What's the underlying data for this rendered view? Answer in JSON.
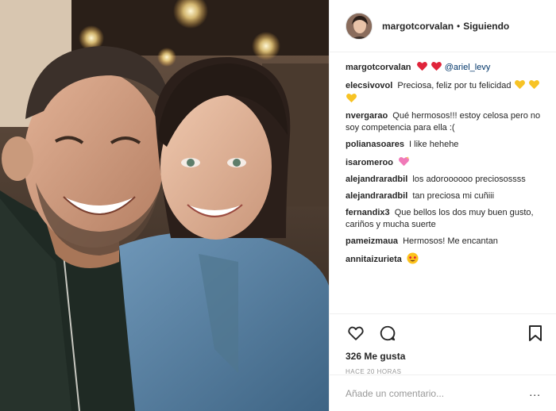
{
  "post": {
    "author": "margotcorvalan",
    "separator": "•",
    "follow_status": "Siguiendo",
    "photo_alt": "selfie"
  },
  "comments": [
    {
      "user": "margotcorvalan",
      "text": "",
      "emoji": [
        "red-heart",
        "red-heart"
      ],
      "mention": "@ariel_levy"
    },
    {
      "user": "elecsivovol",
      "text": "Preciosa, feliz por tu felicidad",
      "emoji": [
        "yellow-heart",
        "yellow-heart",
        "yellow-heart"
      ]
    },
    {
      "user": "nvergarao",
      "text": "Qué hermosos!!! estoy celosa pero no soy competencia para ella :("
    },
    {
      "user": "polianasoares",
      "text": "I like hehehe"
    },
    {
      "user": "isaromeroo",
      "text": "",
      "emoji": [
        "sparkling-heart"
      ]
    },
    {
      "user": "alejandraradbil",
      "text": "los adoroooooo preciosossss"
    },
    {
      "user": "alejandraradbil",
      "text": "tan preciosa mi cuñiii"
    },
    {
      "user": "fernandix3",
      "text": "Que bellos los dos muy buen gusto, cariños y mucha suerte"
    },
    {
      "user": "pameizmaua",
      "text": "Hermosos! Me encantan"
    },
    {
      "user": "annitaizurieta",
      "text": "",
      "emoji": [
        "heart-eyes"
      ]
    }
  ],
  "likes": "326 Me gusta",
  "timestamp": "HACE 20 HORAS",
  "add_comment": {
    "placeholder": "Añade un comentario...",
    "more": "..."
  },
  "colors": {
    "border": "#efefef",
    "text": "#262626",
    "muted": "#999999",
    "mention": "#003569",
    "heart_red": "#ed4956",
    "heart_yellow": "#f7c325"
  }
}
